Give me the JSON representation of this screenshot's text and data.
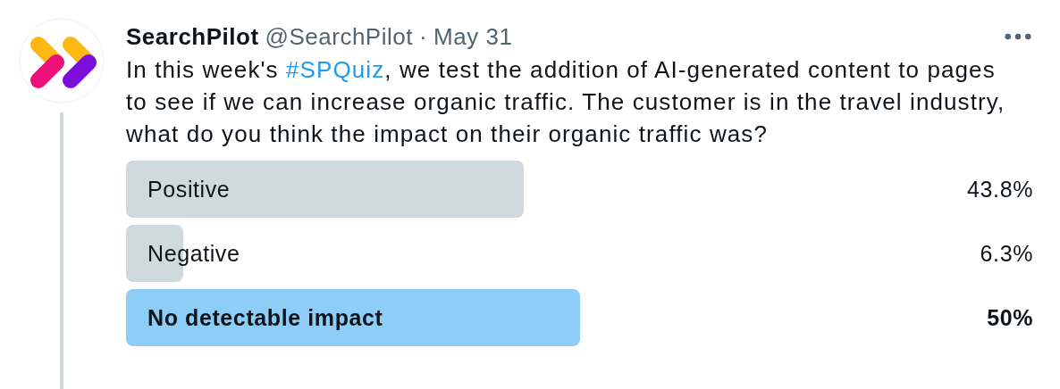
{
  "author": {
    "name": "SearchPilot",
    "handle": "@SearchPilot",
    "separator": "·",
    "date": "May 31"
  },
  "hashtag": {
    "before": "In this week's ",
    "tag": "#SPQuiz",
    "after": ", we test the addition of AI-generated content to pages to see if we can increase organic traffic. The customer is in the travel industry, what do you think the impact on their organic traffic was?"
  },
  "poll": [
    {
      "label": "Positive",
      "percent": "43.8%",
      "level": 0.438,
      "leading": false
    },
    {
      "label": "Negative",
      "percent": "6.3%",
      "level": 0.063,
      "leading": false
    },
    {
      "label": "No detectable impact",
      "percent": "50%",
      "level": 0.5,
      "leading": true
    }
  ]
}
